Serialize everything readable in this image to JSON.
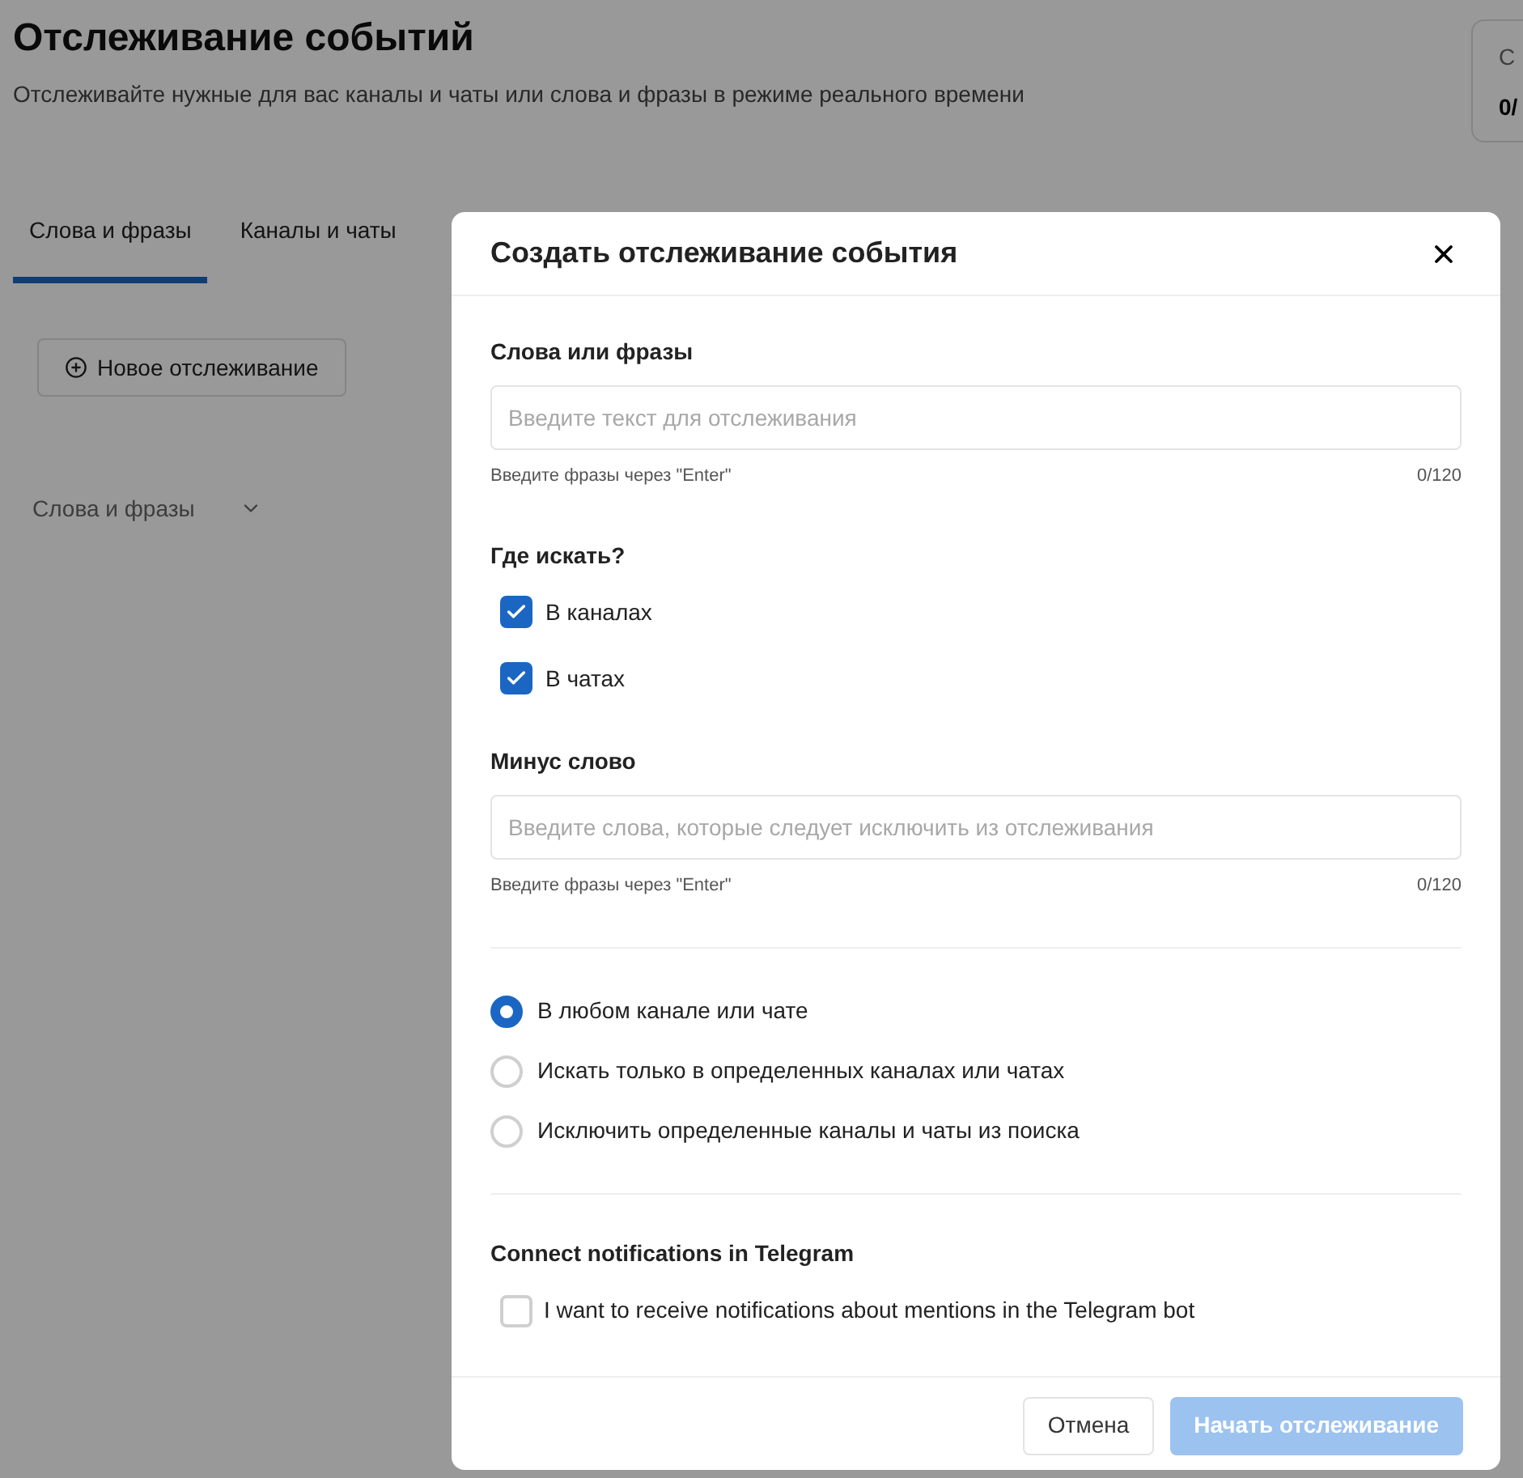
{
  "page": {
    "title": "Отслеживание событий",
    "subtitle": "Отслеживайте нужные для вас каналы и чаты или слова и фразы в режиме реального времени",
    "stat_card": {
      "label": "С",
      "value": "0/"
    }
  },
  "tabs": [
    {
      "label": "Слова и фразы",
      "selected": true
    },
    {
      "label": "Каналы и чаты",
      "selected": false
    }
  ],
  "new_button": {
    "label": "Новое отслеживание"
  },
  "filter": {
    "value": "Слова и фразы"
  },
  "modal": {
    "title": "Создать отслеживание события",
    "phrases": {
      "label": "Слова или фразы",
      "placeholder": "Введите текст для отслеживания",
      "hint": "Введите фразы через \"Enter\"",
      "counter": "0/120"
    },
    "where": {
      "label": "Где искать?",
      "options": [
        {
          "label": "В каналах",
          "checked": true
        },
        {
          "label": "В чатах",
          "checked": true
        }
      ]
    },
    "minus": {
      "label": "Минус слово",
      "placeholder": "Введите слова, которые следует исключить из отслеживания",
      "hint": "Введите фразы через \"Enter\"",
      "counter": "0/120"
    },
    "scope": [
      {
        "label": "В любом канале или чате",
        "selected": true
      },
      {
        "label": "Искать только в определенных каналах или чатах",
        "selected": false
      },
      {
        "label": "Исключить определенные каналы и чаты из поиска",
        "selected": false
      }
    ],
    "telegram": {
      "label": "Connect notifications in Telegram",
      "option": {
        "label": "I want to receive notifications about mentions in the Telegram bot",
        "checked": false
      }
    },
    "cancel": "Отмена",
    "submit": {
      "label": "Начать отслеживание",
      "disabled": true
    }
  }
}
